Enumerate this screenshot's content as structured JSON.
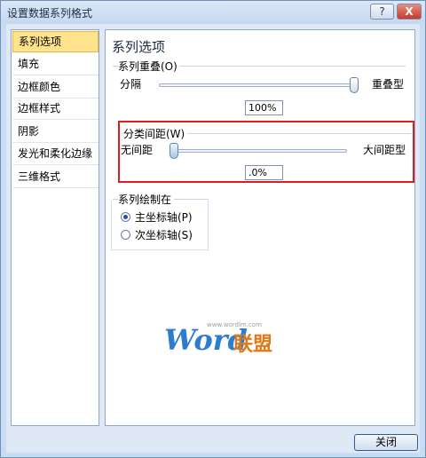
{
  "window": {
    "title": "设置数据系列格式",
    "help_glyph": "?",
    "close_glyph": "X"
  },
  "sidebar": {
    "items": [
      {
        "label": "系列选项",
        "selected": true
      },
      {
        "label": "填充"
      },
      {
        "label": "边框颜色"
      },
      {
        "label": "边框样式"
      },
      {
        "label": "阴影"
      },
      {
        "label": "发光和柔化边缘"
      },
      {
        "label": "三维格式"
      }
    ]
  },
  "panel": {
    "title": "系列选项",
    "overlap": {
      "legend": "系列重叠(O)",
      "left_label": "分隔",
      "right_label": "重叠型",
      "value": "100%",
      "level_percent": 100
    },
    "gap": {
      "legend": "分类间距(W)",
      "left_label": "无间距",
      "right_label": "大间距型",
      "value": ".0%",
      "level_percent": 0
    },
    "plot_on": {
      "legend": "系列绘制在",
      "options": [
        "主坐标轴(P)",
        "次坐标轴(S)"
      ],
      "selected_index": 0
    }
  },
  "watermark": {
    "url": "www.wordlm.com",
    "brand_en": "Word",
    "brand_cn": "联盟"
  },
  "footer": {
    "close_label": "关闭"
  },
  "colors": {
    "highlight": "#e01d1d",
    "selected_nav": "#ffe38c",
    "watermark_blue": "#2e7cd0",
    "watermark_orange": "#e07a18"
  }
}
